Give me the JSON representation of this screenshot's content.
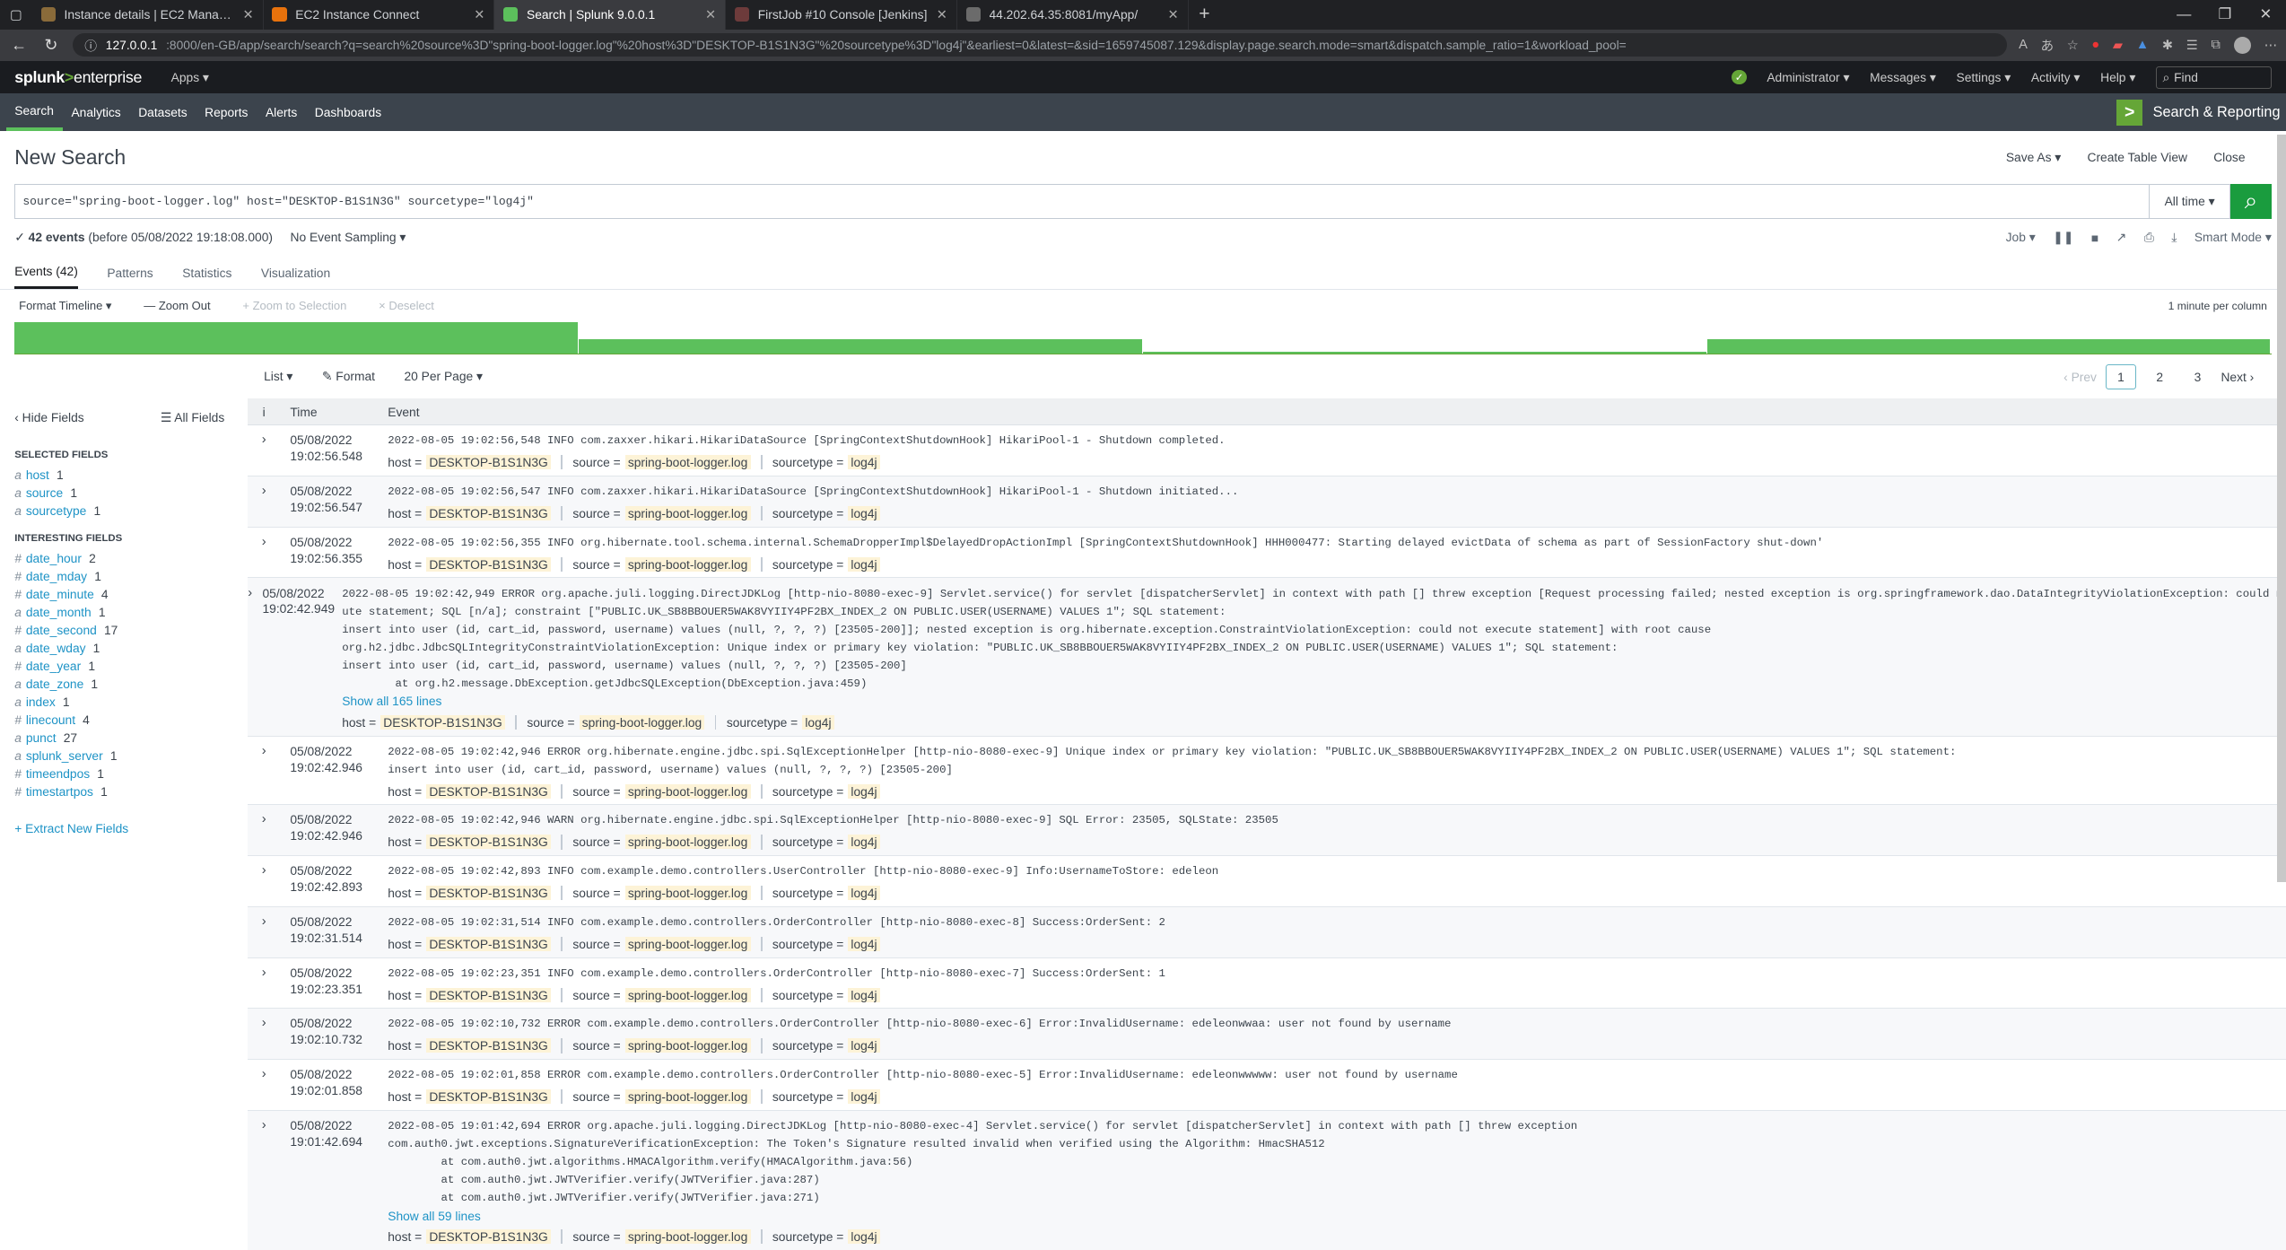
{
  "browser": {
    "tabs": [
      {
        "label": "Instance details | EC2 Managem...",
        "color": "#8a6b3a",
        "active": false
      },
      {
        "label": "EC2 Instance Connect",
        "color": "#e8720c",
        "active": false
      },
      {
        "label": "Search | Splunk 9.0.0.1",
        "color": "#5cc05c",
        "active": true
      },
      {
        "label": "FirstJob #10 Console [Jenkins]",
        "color": "#6d3b3b",
        "active": false
      },
      {
        "label": "44.202.64.35:8081/myApp/",
        "color": "#6b6b6b",
        "active": false
      }
    ],
    "url_host": "127.0.0.1",
    "url_rest": ":8000/en-GB/app/search/search?q=search%20source%3D\"spring-boot-logger.log\"%20host%3D\"DESKTOP-B1S1N3G\"%20sourcetype%3D\"log4j\"&earliest=0&latest=&sid=1659745087.129&display.page.search.mode=smart&dispatch.sample_ratio=1&workload_pool="
  },
  "splunk": {
    "logo_main": "splunk",
    "logo_gt": ">",
    "logo_ent": "enterprise",
    "apps": "Apps ▾",
    "top_menu": [
      "Administrator ▾",
      "Messages ▾",
      "Settings ▾",
      "Activity ▾",
      "Help ▾"
    ],
    "find": "Find",
    "nav": [
      "Search",
      "Analytics",
      "Datasets",
      "Reports",
      "Alerts",
      "Dashboards"
    ],
    "app_name": "Search & Reporting"
  },
  "page": {
    "title": "New Search",
    "actions": [
      "Save As ▾",
      "Create Table View",
      "Close"
    ],
    "query": "source=\"spring-boot-logger.log\" host=\"DESKTOP-B1S1N3G\" sourcetype=\"log4j\"",
    "time_range": "All time ▾",
    "event_count": "42 events",
    "event_range": "(before 05/08/2022 19:18:08.000)",
    "sampling": "No Event Sampling ▾",
    "job": "Job ▾",
    "mode": "Smart Mode ▾",
    "tabs": [
      "Events (42)",
      "Patterns",
      "Statistics",
      "Visualization"
    ],
    "timeline_controls": {
      "format": "Format Timeline ▾",
      "zoom_out": "— Zoom Out",
      "zoom_sel": "+ Zoom to Selection",
      "deselect": "× Deselect",
      "per_col": "1 minute per column"
    },
    "list_controls": {
      "list": "List ▾",
      "format": "Format",
      "per_page": "20 Per Page ▾"
    },
    "pager": {
      "prev": "‹ Prev",
      "pages": [
        "1",
        "2",
        "3"
      ],
      "next": "Next ›"
    }
  },
  "timeline_bars": [
    {
      "col": 0,
      "level": 1.0
    },
    {
      "col": 1,
      "level": 0.45
    },
    {
      "col": 2,
      "level": 0.05
    },
    {
      "col": 3,
      "level": 0.45
    }
  ],
  "sidebar": {
    "hide": "‹ Hide Fields",
    "all": "☰ All Fields",
    "selected_title": "SELECTED FIELDS",
    "selected": [
      {
        "t": "a",
        "n": "host",
        "c": "1"
      },
      {
        "t": "a",
        "n": "source",
        "c": "1"
      },
      {
        "t": "a",
        "n": "sourcetype",
        "c": "1"
      }
    ],
    "interesting_title": "INTERESTING FIELDS",
    "interesting": [
      {
        "t": "#",
        "n": "date_hour",
        "c": "2"
      },
      {
        "t": "#",
        "n": "date_mday",
        "c": "1"
      },
      {
        "t": "#",
        "n": "date_minute",
        "c": "4"
      },
      {
        "t": "a",
        "n": "date_month",
        "c": "1"
      },
      {
        "t": "#",
        "n": "date_second",
        "c": "17"
      },
      {
        "t": "a",
        "n": "date_wday",
        "c": "1"
      },
      {
        "t": "#",
        "n": "date_year",
        "c": "1"
      },
      {
        "t": "a",
        "n": "date_zone",
        "c": "1"
      },
      {
        "t": "a",
        "n": "index",
        "c": "1"
      },
      {
        "t": "#",
        "n": "linecount",
        "c": "4"
      },
      {
        "t": "a",
        "n": "punct",
        "c": "27"
      },
      {
        "t": "a",
        "n": "splunk_server",
        "c": "1"
      },
      {
        "t": "#",
        "n": "timeendpos",
        "c": "1"
      },
      {
        "t": "#",
        "n": "timestartpos",
        "c": "1"
      }
    ],
    "extract": "+ Extract New Fields"
  },
  "table_head": {
    "i": "i",
    "time": "Time",
    "event": "Event"
  },
  "meta_labels": {
    "host": "host =",
    "source": "source =",
    "sourcetype": "sourcetype ="
  },
  "events": [
    {
      "date": "05/08/2022",
      "time": "19:02:56.548",
      "raw": "2022-08-05 19:02:56,548 INFO com.zaxxer.hikari.HikariDataSource [SpringContextShutdownHook] HikariPool-1 - Shutdown completed.",
      "host": "DESKTOP-B1S1N3G",
      "source": "spring-boot-logger.log",
      "sourcetype": "log4j"
    },
    {
      "date": "05/08/2022",
      "time": "19:02:56.547",
      "raw": "2022-08-05 19:02:56,547 INFO com.zaxxer.hikari.HikariDataSource [SpringContextShutdownHook] HikariPool-1 - Shutdown initiated...",
      "host": "DESKTOP-B1S1N3G",
      "source": "spring-boot-logger.log",
      "sourcetype": "log4j"
    },
    {
      "date": "05/08/2022",
      "time": "19:02:56.355",
      "raw": "2022-08-05 19:02:56,355 INFO org.hibernate.tool.schema.internal.SchemaDropperImpl$DelayedDropActionImpl [SpringContextShutdownHook] HHH000477: Starting delayed evictData of schema as part of SessionFactory shut-down'",
      "host": "DESKTOP-B1S1N3G",
      "source": "spring-boot-logger.log",
      "sourcetype": "log4j"
    },
    {
      "date": "05/08/2022",
      "time": "19:02:42.949",
      "raw": "2022-08-05 19:02:42,949 ERROR org.apache.juli.logging.DirectJDKLog [http-nio-8080-exec-9] Servlet.service() for servlet [dispatcherServlet] in context with path [] threw exception [Request processing failed; nested exception is org.springframework.dao.DataIntegrityViolationException: could not exec\nute statement; SQL [n/a]; constraint [\"PUBLIC.UK_SB8BBOUER5WAK8VYIIY4PF2BX_INDEX_2 ON PUBLIC.USER(USERNAME) VALUES 1\"; SQL statement:\ninsert into user (id, cart_id, password, username) values (null, ?, ?, ?) [23505-200]]; nested exception is org.hibernate.exception.ConstraintViolationException: could not execute statement] with root cause\norg.h2.jdbc.JdbcSQLIntegrityConstraintViolationException: Unique index or primary key violation: \"PUBLIC.UK_SB8BBOUER5WAK8VYIIY4PF2BX_INDEX_2 ON PUBLIC.USER(USERNAME) VALUES 1\"; SQL statement:\ninsert into user (id, cart_id, password, username) values (null, ?, ?, ?) [23505-200]\n        at org.h2.message.DbException.getJdbcSQLException(DbException.java:459)",
      "showall": "Show all 165 lines",
      "host": "DESKTOP-B1S1N3G",
      "source": "spring-boot-logger.log",
      "sourcetype": "log4j"
    },
    {
      "date": "05/08/2022",
      "time": "19:02:42.946",
      "raw": "2022-08-05 19:02:42,946 ERROR org.hibernate.engine.jdbc.spi.SqlExceptionHelper [http-nio-8080-exec-9] Unique index or primary key violation: \"PUBLIC.UK_SB8BBOUER5WAK8VYIIY4PF2BX_INDEX_2 ON PUBLIC.USER(USERNAME) VALUES 1\"; SQL statement:\ninsert into user (id, cart_id, password, username) values (null, ?, ?, ?) [23505-200]",
      "host": "DESKTOP-B1S1N3G",
      "source": "spring-boot-logger.log",
      "sourcetype": "log4j"
    },
    {
      "date": "05/08/2022",
      "time": "19:02:42.946",
      "raw": "2022-08-05 19:02:42,946 WARN org.hibernate.engine.jdbc.spi.SqlExceptionHelper [http-nio-8080-exec-9] SQL Error: 23505, SQLState: 23505",
      "host": "DESKTOP-B1S1N3G",
      "source": "spring-boot-logger.log",
      "sourcetype": "log4j"
    },
    {
      "date": "05/08/2022",
      "time": "19:02:42.893",
      "raw": "2022-08-05 19:02:42,893 INFO com.example.demo.controllers.UserController [http-nio-8080-exec-9] Info:UsernameToStore: edeleon",
      "host": "DESKTOP-B1S1N3G",
      "source": "spring-boot-logger.log",
      "sourcetype": "log4j"
    },
    {
      "date": "05/08/2022",
      "time": "19:02:31.514",
      "raw": "2022-08-05 19:02:31,514 INFO com.example.demo.controllers.OrderController [http-nio-8080-exec-8] Success:OrderSent: 2",
      "host": "DESKTOP-B1S1N3G",
      "source": "spring-boot-logger.log",
      "sourcetype": "log4j"
    },
    {
      "date": "05/08/2022",
      "time": "19:02:23.351",
      "raw": "2022-08-05 19:02:23,351 INFO com.example.demo.controllers.OrderController [http-nio-8080-exec-7] Success:OrderSent: 1",
      "host": "DESKTOP-B1S1N3G",
      "source": "spring-boot-logger.log",
      "sourcetype": "log4j"
    },
    {
      "date": "05/08/2022",
      "time": "19:02:10.732",
      "raw": "2022-08-05 19:02:10,732 ERROR com.example.demo.controllers.OrderController [http-nio-8080-exec-6] Error:InvalidUsername: edeleonwwaa: user not found by username",
      "host": "DESKTOP-B1S1N3G",
      "source": "spring-boot-logger.log",
      "sourcetype": "log4j"
    },
    {
      "date": "05/08/2022",
      "time": "19:02:01.858",
      "raw": "2022-08-05 19:02:01,858 ERROR com.example.demo.controllers.OrderController [http-nio-8080-exec-5] Error:InvalidUsername: edeleonwwwww: user not found by username",
      "host": "DESKTOP-B1S1N3G",
      "source": "spring-boot-logger.log",
      "sourcetype": "log4j"
    },
    {
      "date": "05/08/2022",
      "time": "19:01:42.694",
      "raw": "2022-08-05 19:01:42,694 ERROR org.apache.juli.logging.DirectJDKLog [http-nio-8080-exec-4] Servlet.service() for servlet [dispatcherServlet] in context with path [] threw exception\ncom.auth0.jwt.exceptions.SignatureVerificationException: The Token's Signature resulted invalid when verified using the Algorithm: HmacSHA512\n        at com.auth0.jwt.algorithms.HMACAlgorithm.verify(HMACAlgorithm.java:56)\n        at com.auth0.jwt.JWTVerifier.verify(JWTVerifier.java:287)\n        at com.auth0.jwt.JWTVerifier.verify(JWTVerifier.java:271)",
      "showall": "Show all 59 lines",
      "host": "DESKTOP-B1S1N3G",
      "source": "spring-boot-logger.log",
      "sourcetype": "log4j"
    }
  ]
}
